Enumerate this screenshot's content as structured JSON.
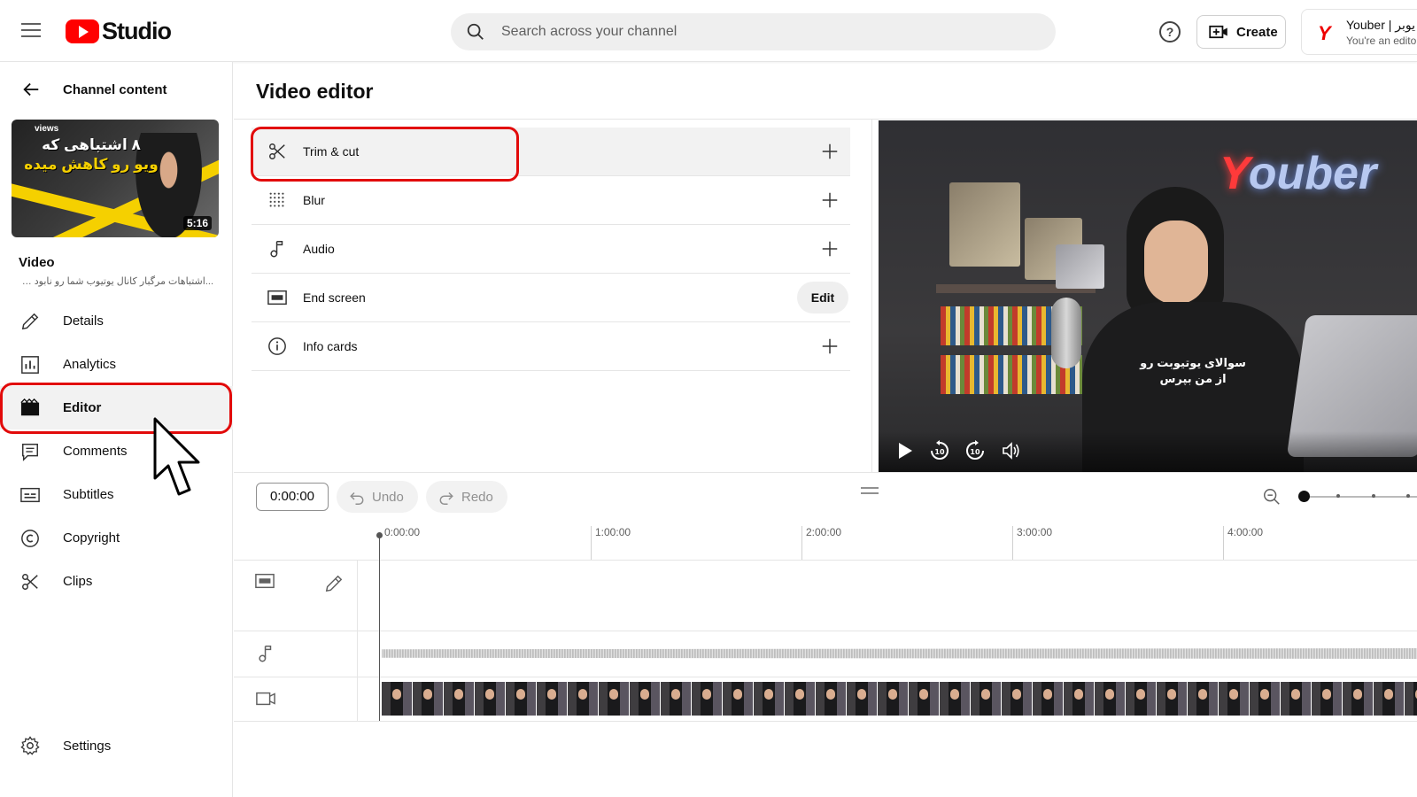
{
  "header": {
    "logo_text": "Studio",
    "search_placeholder": "Search across your channel",
    "help_label": "?",
    "create_label": "Create",
    "account_name": "Youber | یوبر",
    "account_sub": "You're an edito"
  },
  "sidebar": {
    "back_label": "Channel content",
    "thumbnail": {
      "views_text": "views",
      "title_line1": "۸ اشتباهی که",
      "title_line2": "ویو رو کاهش میده",
      "duration": "5:16"
    },
    "video_label": "Video",
    "video_title": "...اشتباهات مرگبار کانال یوتیوب شما رو نابود میکنه",
    "nav_items": [
      {
        "label": "Details",
        "icon": "pencil-icon"
      },
      {
        "label": "Analytics",
        "icon": "analytics-icon"
      },
      {
        "label": "Editor",
        "icon": "clapperboard-icon",
        "active": true
      },
      {
        "label": "Comments",
        "icon": "comment-icon"
      },
      {
        "label": "Subtitles",
        "icon": "subtitles-icon"
      },
      {
        "label": "Copyright",
        "icon": "copyright-icon"
      },
      {
        "label": "Clips",
        "icon": "scissors-icon"
      }
    ],
    "settings_label": "Settings"
  },
  "main": {
    "page_title": "Video editor",
    "tools": [
      {
        "label": "Trim & cut",
        "icon": "scissors-icon",
        "action": "add"
      },
      {
        "label": "Blur",
        "icon": "blur-icon",
        "action": "add"
      },
      {
        "label": "Audio",
        "icon": "music-note-icon",
        "action": "add"
      },
      {
        "label": "End screen",
        "icon": "end-screen-icon",
        "action": "edit",
        "action_label": "Edit"
      },
      {
        "label": "Info cards",
        "icon": "info-icon",
        "action": "add"
      }
    ],
    "player": {
      "brand_text": "ouber",
      "brand_letter": "Y",
      "shirt_line1": "سوالای یوتیوبت رو",
      "shirt_line2": "از من بپرس"
    }
  },
  "timeline": {
    "current_time": "0:00:00",
    "undo_label": "Undo",
    "redo_label": "Redo",
    "ruler": [
      "0:00:00",
      "1:00:00",
      "2:00:00",
      "3:00:00",
      "4:00:00"
    ]
  },
  "colors": {
    "highlight_red": "#e20a0a",
    "brand_red": "#ff0000"
  }
}
